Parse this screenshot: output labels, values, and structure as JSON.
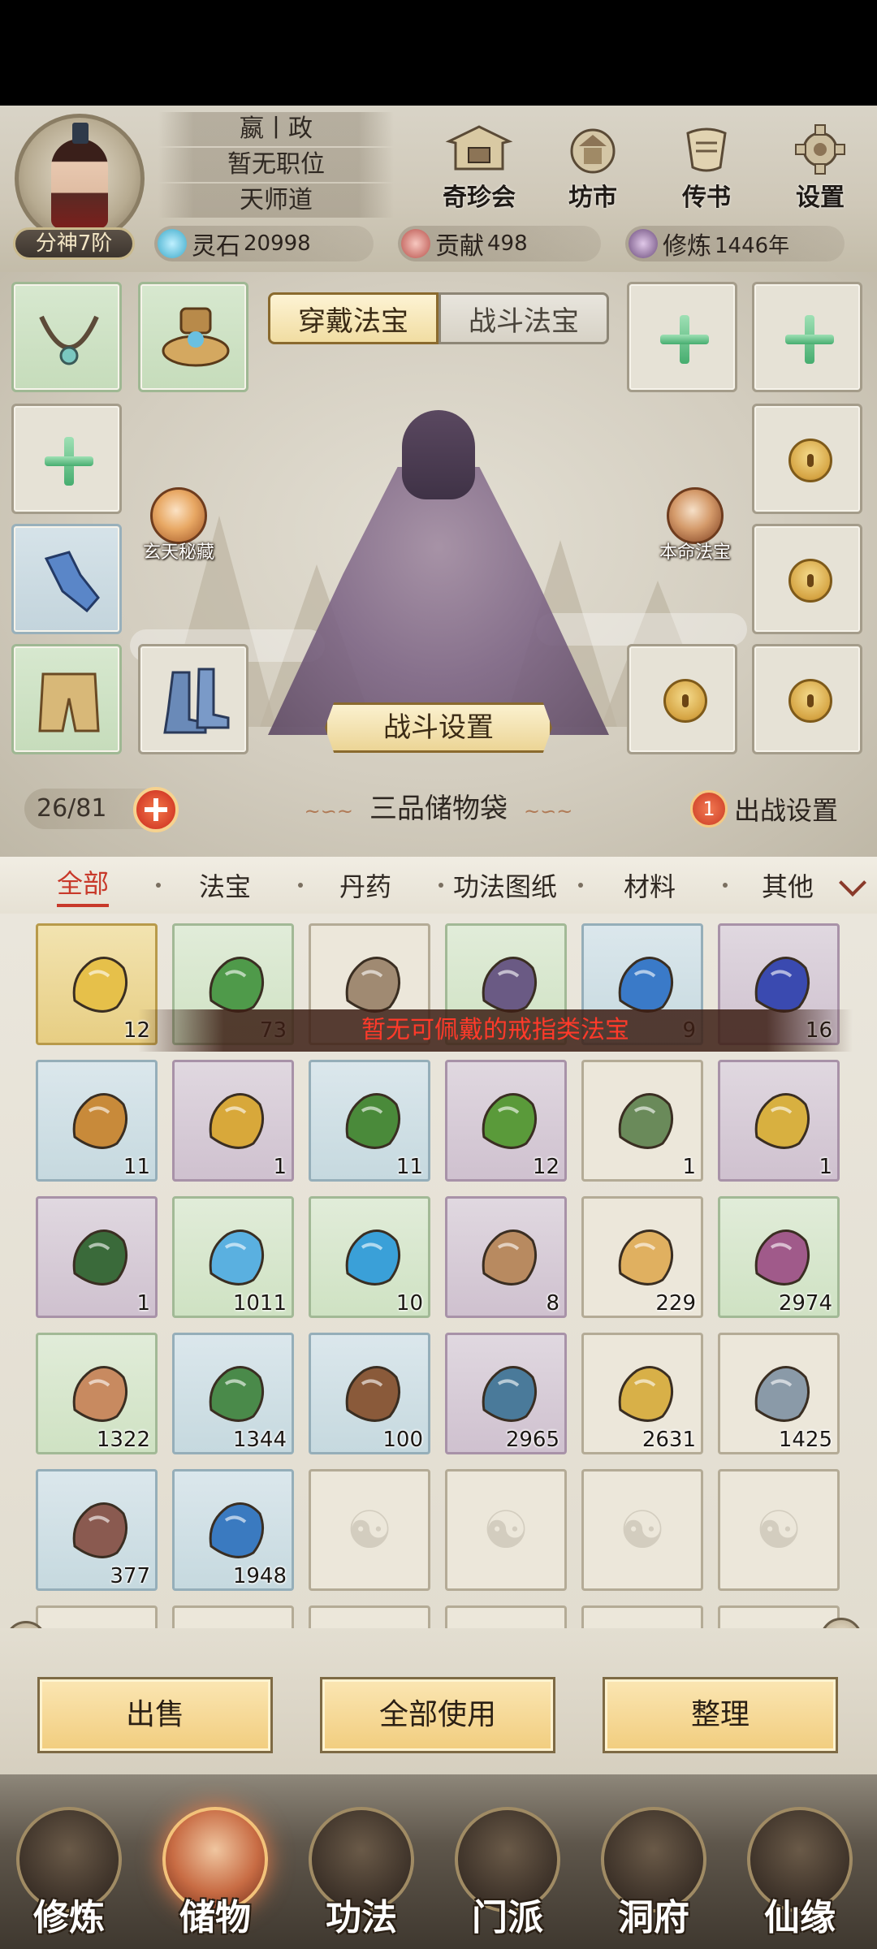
{
  "player": {
    "name": "嬴丨政",
    "position": "暂无职位",
    "sect_path": "天师道",
    "rank": "分神7阶"
  },
  "top_menu": [
    {
      "label": "奇珍会",
      "icon": "treasure-pavilion-icon"
    },
    {
      "label": "坊市",
      "icon": "market-icon"
    },
    {
      "label": "传书",
      "icon": "scroll-letter-icon"
    },
    {
      "label": "设置",
      "icon": "gear-icon"
    }
  ],
  "resources": {
    "spirit_stone": {
      "label": "灵石",
      "value": "20998"
    },
    "contribution": {
      "label": "贡献",
      "value": "498"
    },
    "cultivation": {
      "label": "修炼",
      "value": "1446年"
    }
  },
  "equip_tabs": {
    "active": "穿戴法宝",
    "inactive": "战斗法宝"
  },
  "side_badges": {
    "left": "玄天秘藏",
    "right": "本命法宝"
  },
  "fight_settings": "战斗设置",
  "bag": {
    "capacity": "26/81",
    "title": "三品储物袋",
    "deploy_count": "1",
    "deploy_label": "出战设置"
  },
  "categories": [
    "全部",
    "法宝",
    "丹药",
    "功法图纸",
    "材料",
    "其他"
  ],
  "toast": "暂无可佩戴的戒指类法宝",
  "items": [
    {
      "name": "gold-ore-item",
      "rarity": "gold",
      "count": "12"
    },
    {
      "name": "herb-sprout-item",
      "rarity": "green",
      "count": "73"
    },
    {
      "name": "stone-item",
      "rarity": "normal",
      "count": ""
    },
    {
      "name": "vase-item",
      "rarity": "green",
      "count": ""
    },
    {
      "name": "blue-grass-item",
      "rarity": "blue",
      "count": "9"
    },
    {
      "name": "blue-flower-item",
      "rarity": "purple",
      "count": "16"
    },
    {
      "name": "dry-grass-item",
      "rarity": "blue",
      "count": "11"
    },
    {
      "name": "golden-grass-item",
      "rarity": "purple",
      "count": "1"
    },
    {
      "name": "leafy-herb-item",
      "rarity": "blue",
      "count": "11"
    },
    {
      "name": "sparkling-herb-item",
      "rarity": "purple",
      "count": "12"
    },
    {
      "name": "jade-glove-item",
      "rarity": "normal",
      "count": "1"
    },
    {
      "name": "gold-ring-item",
      "rarity": "purple",
      "count": "1"
    },
    {
      "name": "jade-bracelet-item",
      "rarity": "purple",
      "count": "1"
    },
    {
      "name": "water-drop-item",
      "rarity": "green",
      "count": "1011"
    },
    {
      "name": "water-swirl-item",
      "rarity": "green",
      "count": "10"
    },
    {
      "name": "wood-token-item",
      "rarity": "purple",
      "count": "8"
    },
    {
      "name": "ginseng-item",
      "rarity": "normal",
      "count": "229"
    },
    {
      "name": "purple-root-item",
      "rarity": "green",
      "count": "2974"
    },
    {
      "name": "root-item",
      "rarity": "green",
      "count": "1322"
    },
    {
      "name": "white-flower-item",
      "rarity": "blue",
      "count": "1344"
    },
    {
      "name": "berry-branch-item",
      "rarity": "blue",
      "count": "100"
    },
    {
      "name": "blue-berry-branch-item",
      "rarity": "purple",
      "count": "2965"
    },
    {
      "name": "gold-nugget-item",
      "rarity": "normal",
      "count": "2631"
    },
    {
      "name": "iron-ore-item",
      "rarity": "normal",
      "count": "1425"
    },
    {
      "name": "red-ore-item",
      "rarity": "blue",
      "count": "377"
    },
    {
      "name": "blue-crystal-item",
      "rarity": "blue",
      "count": "1948"
    }
  ],
  "actions": {
    "sell": "出售",
    "use_all": "全部使用",
    "sort": "整理"
  },
  "nav": [
    {
      "label": "修炼"
    },
    {
      "label": "储物"
    },
    {
      "label": "功法"
    },
    {
      "label": "门派"
    },
    {
      "label": "洞府"
    },
    {
      "label": "仙缘"
    }
  ],
  "colors": {
    "accent_red": "#c8392a",
    "gold": "#f1cd7e",
    "parchment": "#e6e1d4"
  }
}
